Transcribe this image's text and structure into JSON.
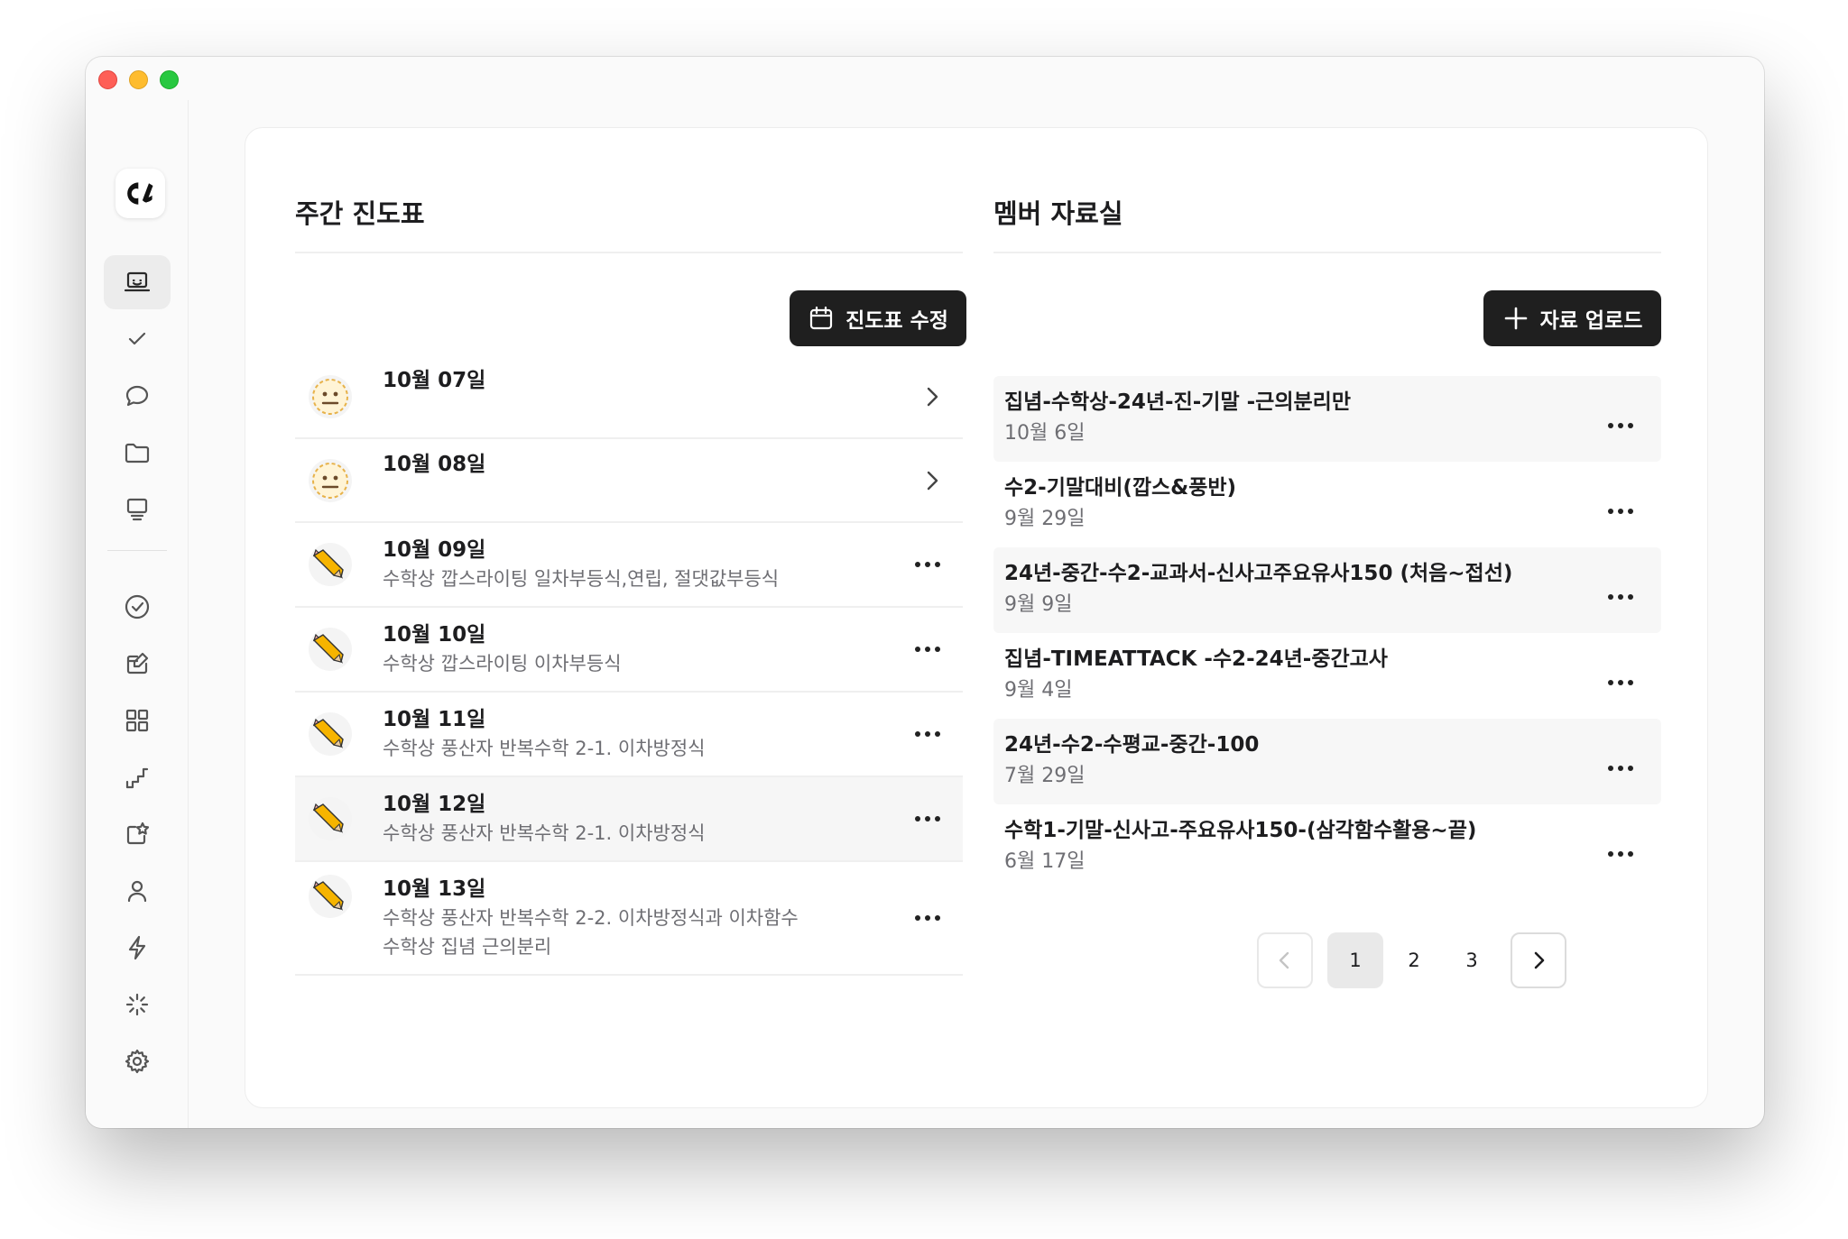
{
  "window": {
    "traffic_lights": [
      "close",
      "minimize",
      "zoom"
    ]
  },
  "sidebar": {
    "logo": "app-logo",
    "items": [
      {
        "name": "dashboard",
        "icon": "laptop-icon",
        "active": true
      },
      {
        "name": "tasks",
        "icon": "check-icon"
      },
      {
        "name": "chat",
        "icon": "chat-bubble-icon"
      },
      {
        "name": "files",
        "icon": "folder-icon"
      },
      {
        "name": "board",
        "icon": "monitor-icon"
      },
      {
        "name": "done",
        "icon": "check-circle-icon"
      },
      {
        "name": "edit",
        "icon": "edit-square-icon"
      },
      {
        "name": "apps",
        "icon": "grid-icon"
      },
      {
        "name": "progress",
        "icon": "stairs-icon"
      },
      {
        "name": "share",
        "icon": "share-star-icon"
      },
      {
        "name": "members",
        "icon": "person-icon"
      },
      {
        "name": "quick",
        "icon": "bolt-icon"
      },
      {
        "name": "loading",
        "icon": "spinner-icon"
      },
      {
        "name": "settings",
        "icon": "gear-icon"
      }
    ]
  },
  "schedule": {
    "title": "주간 진도표",
    "edit_button": "진도표 수정",
    "rows": [
      {
        "date": "10월 07일",
        "subtitle": "",
        "emoji": "neutral-face",
        "action": "chevron"
      },
      {
        "date": "10월 08일",
        "subtitle": "",
        "emoji": "neutral-face",
        "action": "chevron"
      },
      {
        "date": "10월 09일",
        "subtitle": "수학상 깝스라이팅 일차부등식,연립, 절댓값부등식",
        "emoji": "pencil",
        "action": "more"
      },
      {
        "date": "10월 10일",
        "subtitle": "수학상 깝스라이팅 이차부등식",
        "emoji": "pencil",
        "action": "more"
      },
      {
        "date": "10월 11일",
        "subtitle": "수학상 풍산자 반복수학 2-1. 이차방정식",
        "emoji": "pencil",
        "action": "more"
      },
      {
        "date": "10월 12일",
        "subtitle": "수학상 풍산자 반복수학 2-1. 이차방정식",
        "emoji": "pencil",
        "action": "more",
        "highlight": true
      },
      {
        "date": "10월 13일",
        "subtitle": "수학상 풍산자 반복수학 2-2. 이차방정식과 이차함수",
        "subtitle2": "수학상 집념 근의분리",
        "emoji": "pencil",
        "action": "more"
      }
    ]
  },
  "resources": {
    "title": "멤버 자료실",
    "upload_button": "자료 업로드",
    "items": [
      {
        "title": "집념-수학상-24년-진-기말 -근의분리만",
        "date": "10월 6일"
      },
      {
        "title": "수2-기말대비(깝스&풍반)",
        "date": "9월 29일"
      },
      {
        "title": "24년-중간-수2-교과서-신사고주요유사150 (처음~접선)",
        "date": "9월 9일"
      },
      {
        "title": "집념-TIMEATTACK -수2-24년-중간고사",
        "date": "9월 4일"
      },
      {
        "title": "24년-수2-수평교-중간-100",
        "date": "7월 29일"
      },
      {
        "title": "수학1-기말-신사고-주요유사150-(삼각함수활용~끝)",
        "date": "6월 17일"
      }
    ],
    "pagination": {
      "pages": [
        "1",
        "2",
        "3"
      ],
      "current": "1"
    }
  }
}
